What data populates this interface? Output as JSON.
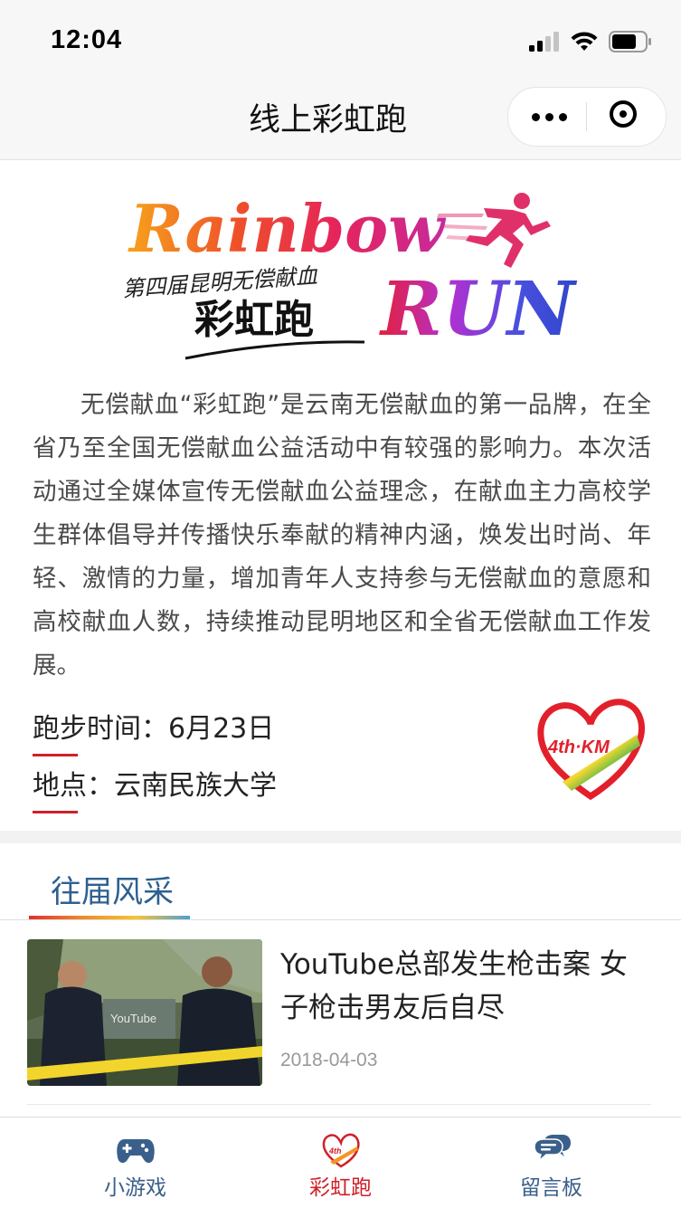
{
  "status_bar": {
    "time": "12:04"
  },
  "nav": {
    "title": "线上彩虹跑"
  },
  "banner": {
    "word_rainbow": "Rainbow",
    "word_run": "RUN",
    "subtitle": "第四届昆明无偿献血",
    "cn_title": "彩虹跑"
  },
  "intro": {
    "description": "无偿献血“彩虹跑”是云南无偿献血的第一品牌，在全省乃至全国无偿献血公益活动中有较强的影响力。本次活动通过全媒体宣传无偿献血公益理念，在献血主力高校学生群体倡导并传播快乐奉献的精神内涵，焕发出时尚、年轻、激情的力量，增加青年人支持参与无偿献血的意愿和高校献血人数，持续推动昆明地区和全省无偿献血工作发展。",
    "time_label": "跑步时间：",
    "time_value": "6月23日",
    "place_label": "地点：",
    "place_value": "云南民族大学",
    "logo_text": "4th·KM"
  },
  "section": {
    "title": "往届风采"
  },
  "news": [
    {
      "title": "YouTube总部发生枪击案 女子枪击男友后自尽",
      "date": "2018-04-03",
      "thumb_text": "YouTube"
    }
  ],
  "tabs": [
    {
      "label": "小游戏",
      "icon": "gamepad-icon"
    },
    {
      "label": "彩虹跑",
      "icon": "rainbow-heart-icon"
    },
    {
      "label": "留言板",
      "icon": "chat-bubble-icon"
    }
  ],
  "colors": {
    "accent": "#d0202a",
    "section_title": "#2e6090",
    "tab_label": "#3a5f8a"
  }
}
